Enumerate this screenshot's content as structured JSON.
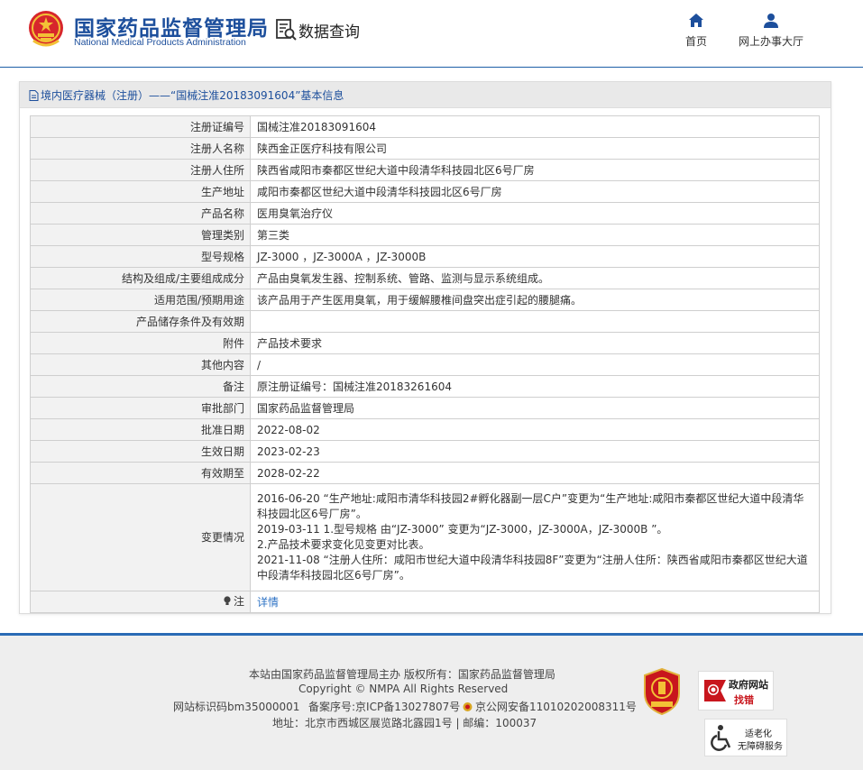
{
  "header": {
    "site_name_cn": "国家药品监督管理局",
    "site_name_en": "National Medical Products Administration",
    "data_query_label": "数据查询",
    "nav": [
      {
        "label": "首页",
        "icon": "home-icon"
      },
      {
        "label": "网上办事大厅",
        "icon": "user-icon"
      }
    ]
  },
  "breadcrumb": {
    "text": "境内医疗器械（注册）——“国械注准20183091604”基本信息",
    "icon": "document-icon"
  },
  "record": {
    "rows": [
      {
        "label": "注册证编号",
        "value": "国械注准20183091604"
      },
      {
        "label": "注册人名称",
        "value": "陕西金正医疗科技有限公司"
      },
      {
        "label": "注册人住所",
        "value": "陕西省咸阳市秦都区世纪大道中段清华科技园北区6号厂房"
      },
      {
        "label": "生产地址",
        "value": "咸阳市秦都区世纪大道中段清华科技园北区6号厂房"
      },
      {
        "label": "产品名称",
        "value": "医用臭氧治疗仪"
      },
      {
        "label": "管理类别",
        "value": "第三类"
      },
      {
        "label": "型号规格",
        "value": "JZ-3000 ，JZ-3000A ，JZ-3000B"
      },
      {
        "label": "结构及组成/主要组成成分",
        "value": "产品由臭氧发生器、控制系统、管路、监测与显示系统组成。"
      },
      {
        "label": "适用范围/预期用途",
        "value": "该产品用于产生医用臭氧，用于缓解腰椎间盘突出症引起的腰腿痛。"
      },
      {
        "label": "产品储存条件及有效期",
        "value": ""
      },
      {
        "label": "附件",
        "value": "产品技术要求"
      },
      {
        "label": "其他内容",
        "value": "/"
      },
      {
        "label": "备注",
        "value": "原注册证编号：国械注准20183261604"
      },
      {
        "label": "审批部门",
        "value": "国家药品监督管理局"
      },
      {
        "label": "批准日期",
        "value": "2022-08-02"
      },
      {
        "label": "生效日期",
        "value": "2023-02-23"
      },
      {
        "label": "有效期至",
        "value": "2028-02-22"
      }
    ],
    "change_label": "变更情况",
    "changes": [
      "2016-06-20 “生产地址:咸阳市清华科技园2#孵化器副一层C户”变更为“生产地址:咸阳市秦都区世纪大道中段清华科技园北区6号厂房”。",
      "2019-03-11 1.型号规格 由“JZ-3000” 变更为“JZ-3000，JZ-3000A，JZ-3000B ”。",
      "2.产品技术要求变化见变更对比表。",
      "2021-11-08 “注册人住所：咸阳市世纪大道中段清华科技园8F”变更为“注册人住所：陕西省咸阳市秦都区世纪大道中段清华科技园北区6号厂房”。"
    ],
    "note_label": "注",
    "note_link": "详情"
  },
  "footer": {
    "host_line": "本站由国家药品监督管理局主办 版权所有：国家药品监督管理局",
    "copyright": "Copyright © NMPA All Rights Reserved",
    "site_id": "网站标识码bm35000001",
    "icp": "备案序号:京ICP备13027807号",
    "police": "京公网安备11010202008311号",
    "address": "地址：北京市西城区展览路北露园1号 | 邮编：100037",
    "badge_gov_error_line1": "政府网站",
    "badge_gov_error_line2": "找错",
    "badge_access_line1": "适老化",
    "badge_access_line2": "无障碍服务",
    "badge_party": "党政机关"
  },
  "colors": {
    "brand_blue": "#1d4f9c",
    "link_blue": "#2e73c5",
    "footer_rule": "#2a6bb5",
    "label_bg": "#f2f2f2"
  }
}
